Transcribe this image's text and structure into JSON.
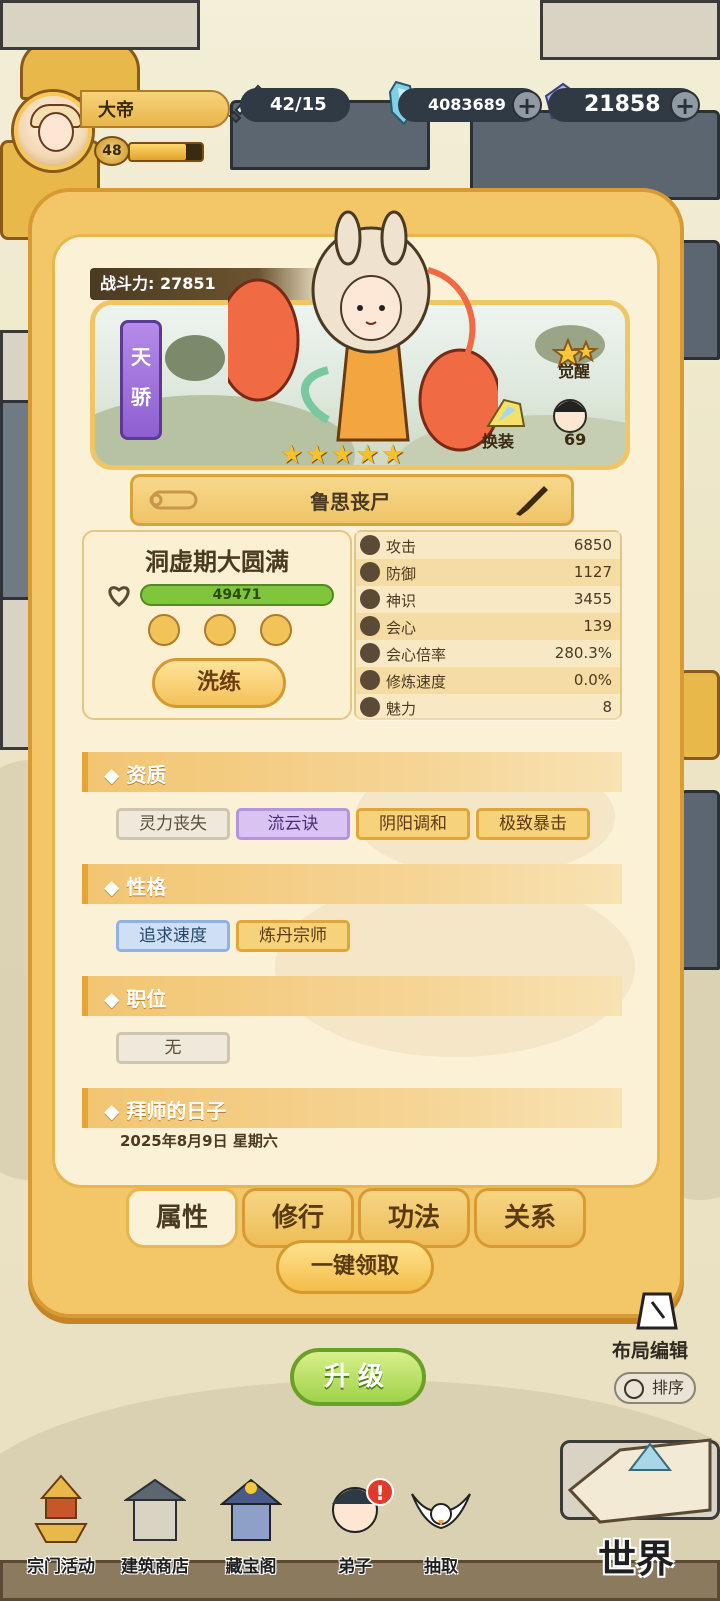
{
  "player": {
    "name": "大帝",
    "level": "48",
    "exp_fraction": 0.78
  },
  "resources": {
    "energy": "42/15",
    "spirit_stones": "4083689",
    "gems": "21858"
  },
  "hero": {
    "power_label": "战斗力: 27851",
    "rank": "天骄",
    "stars": 5,
    "awaken_label": "觉醒",
    "dress_label": "换装",
    "disciple_count": "69",
    "name": "鲁思丧尸",
    "realm": "洞虚期大圆满",
    "hp": "49471",
    "refine_label": "洗练"
  },
  "stats": [
    {
      "label": "攻击",
      "value": "6850"
    },
    {
      "label": "防御",
      "value": "1127"
    },
    {
      "label": "神识",
      "value": "3455"
    },
    {
      "label": "会心",
      "value": "139"
    },
    {
      "label": "会心倍率",
      "value": "280.3%"
    },
    {
      "label": "修炼速度",
      "value": "0.0%"
    },
    {
      "label": "魅力",
      "value": "8"
    }
  ],
  "sections": {
    "aptitude": {
      "title": "◆ 资质",
      "tags": [
        "灵力丧失",
        "流云诀",
        "阴阳调和",
        "极致暴击"
      ]
    },
    "personality": {
      "title": "◆ 性格",
      "tags": [
        "追求速度",
        "炼丹宗师"
      ]
    },
    "position": {
      "title": "◆ 职位",
      "tags": [
        "无"
      ]
    },
    "apprentice": {
      "title": "◆ 拜师的日子",
      "date": "2025年8月9日 星期六"
    }
  },
  "tabs": [
    "属性",
    "修行",
    "功法",
    "关系"
  ],
  "buttons": {
    "claim_all": "一键领取",
    "upgrade": "升级",
    "layout_edit": "布局编辑",
    "sort": "排序",
    "world": "世界"
  },
  "nav": [
    "宗门活动",
    "建筑商店",
    "藏宝阁",
    "弟子",
    "抽取"
  ],
  "nav_alert": "!"
}
